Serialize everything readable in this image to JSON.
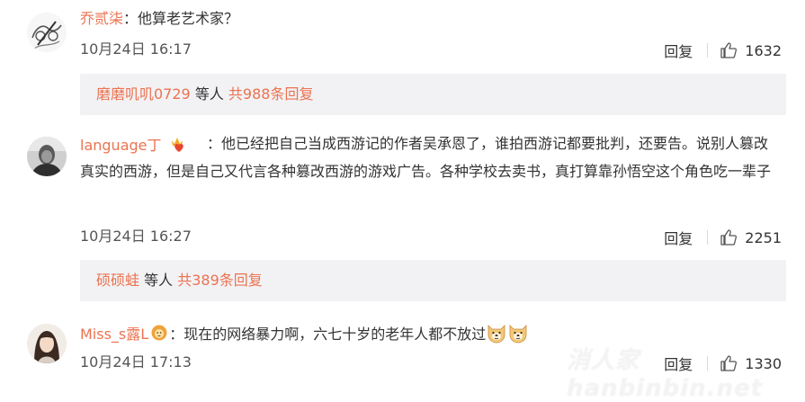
{
  "comments": [
    {
      "username": "乔贰柒",
      "text": "：他算老艺术家？",
      "time": "10月24日 16:17",
      "reply_label": "回复",
      "likes": "1632",
      "avatar_icon": "sketch-avatar"
    },
    {
      "username": "language丁",
      "text": "：他已经把自己当成西游记的作者吴承恩了，谁拍西游记都要批判，还要告。说别人篡改真实的西游，但是自己又代言各种篡改西游的游戏广告。各种学校去卖书，真打算靠孙悟空这个角色吃一辈子",
      "time": "10月24日 16:27",
      "reply_label": "回复",
      "likes": "2251",
      "avatar_icon": "grayscale-portrait-avatar",
      "badge_icon": "crown-heart-badge"
    },
    {
      "username": "Miss_s露L",
      "text": "：现在的网络暴力啊，六七十岁的老年人都不放过",
      "time": "10月24日 17:13",
      "reply_label": "回复",
      "likes": "1330",
      "avatar_icon": "girl-portrait-avatar",
      "badge_icon": "lion-badge",
      "emoji_icon": "doge-emoji"
    }
  ],
  "reply_threads": [
    {
      "user": "磨磨叽叽0729",
      "mid": " 等人 ",
      "total": "共988条回复"
    },
    {
      "user": "硕硕蛙",
      "mid": " 等人 ",
      "total": "共389条回复"
    }
  ],
  "watermark": "消人家hanbinbin.net",
  "colors": {
    "username": "#eb7350",
    "reply_bg": "#f2f2f5",
    "text": "#333333"
  }
}
